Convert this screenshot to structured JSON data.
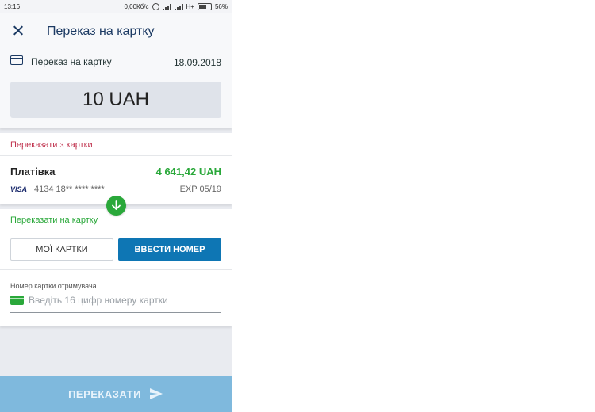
{
  "status_bar": {
    "time": "13:16",
    "net_speed": "0,00Кб/с",
    "network": "H+",
    "battery": "56%"
  },
  "app_bar": {
    "title": "Переказ на картку",
    "close_icon": "close-icon"
  },
  "header": {
    "type_icon": "card-icon",
    "type_label": "Переказ на картку",
    "date": "18.09.2018",
    "amount": "10 UAH"
  },
  "from": {
    "section_label": "Переказати з картки",
    "card_name": "Платівка",
    "balance": "4 641,42 UAH",
    "brand": "VISA",
    "card_number": "4134 18** **** ****",
    "expiry": "EXP 05/19"
  },
  "to": {
    "section_label": "Переказати на картку",
    "tab_my_cards": "МОЇ КАРТКИ",
    "tab_enter_number": "ВВЕСТИ НОМЕР",
    "field_label": "Номер картки отримувача",
    "field_placeholder": "Введіть 16 цифр номеру картки",
    "field_value": ""
  },
  "submit": {
    "label": "ПЕРЕКАЗАТИ",
    "icon": "send-icon"
  },
  "colors": {
    "brand": "#1c3a63",
    "accent": "#0e76b4",
    "success": "#2aa83a",
    "danger": "#c0334e",
    "disabled_button": "#7fb9dd"
  }
}
